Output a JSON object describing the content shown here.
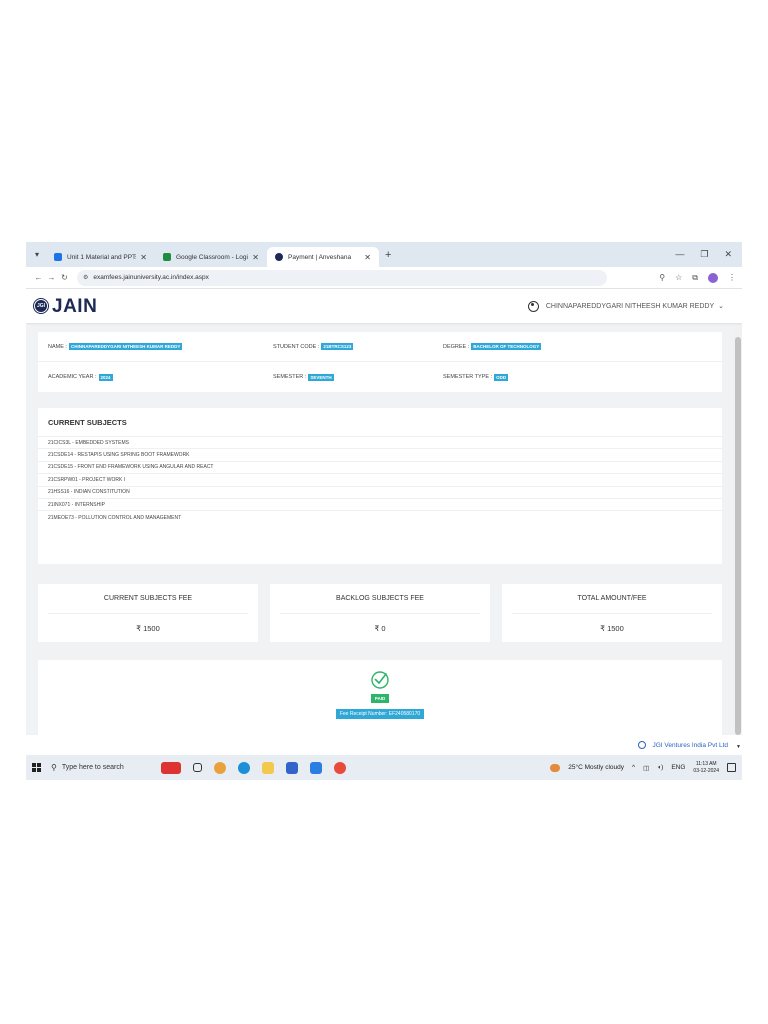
{
  "browser": {
    "tabs": [
      {
        "label": "Unit 1 Material and PPTs",
        "icon": "docs-icon",
        "color": "#1a73e8"
      },
      {
        "label": "Google Classroom - Login",
        "icon": "classroom-icon",
        "color": "#1e8e3e"
      },
      {
        "label": "Payment | Anveshana",
        "icon": "site-icon",
        "color": "#1c2a55"
      }
    ],
    "new_tab": "+",
    "url": "examfees.jainuniversity.ac.in/index.aspx"
  },
  "header": {
    "logo_badge": "JGI",
    "logo_text": "JAIN",
    "user_name": "CHINNAPAREDDYGARI NITHEESH KUMAR REDDY"
  },
  "student": {
    "name_label": "NAME :",
    "name_value": "CHINNAPAREDDYGARI NITHEESH KUMAR REDDY",
    "code_label": "STUDENT CODE :",
    "code_value": "21BTRCS123",
    "degree_label": "DEGREE :",
    "degree_value": "BACHELOR OF TECHNOLOGY",
    "year_label": "ACADEMIC YEAR :",
    "year_value": "2024",
    "semester_label": "SEMESTER :",
    "semester_value": "SEVENTH",
    "semtype_label": "SEMESTER TYPE :",
    "semtype_value": "ODD"
  },
  "subjects": {
    "title": "CURRENT SUBJECTS",
    "items": [
      "21CICS3L - EMBEDDED SYSTEMS",
      "21CSDE14 - RESTAPIS USING SPRING BOOT FRAMEWORK",
      "21CSDE15 - FRONT END FRAMEWORK USING ANGULAR AND REACT",
      "21CSRPW01 - PROJECT WORK I",
      "21HSS16 - INDIAN CONSTITUTION",
      "21INX071 - INTERNSHIP",
      "21MEOE73 - POLLUTION CONTROL AND MANAGEMENT"
    ]
  },
  "fees": {
    "current_label": "CURRENT SUBJECTS FEE",
    "current_value": "₹ 1500",
    "backlog_label": "BACKLOG SUBJECTS FEE",
    "backlog_value": "₹ 0",
    "total_label": "TOTAL AMOUNT/FEE",
    "total_value": "₹ 1500"
  },
  "payment": {
    "status": "PAID",
    "receipt": "Fee Receipt Number: EF240580170"
  },
  "footer": {
    "brand": "JGI Ventures India Pvt Ltd"
  },
  "taskbar": {
    "search_placeholder": "Type here to search",
    "weather": "25°C  Mostly cloudy",
    "lang": "ENG",
    "time": "11:13 AM",
    "date": "03-12-2024"
  },
  "colors": {
    "badge": "#2fa8d8",
    "paid": "#2db56a",
    "brand_navy": "#1c2a55"
  }
}
